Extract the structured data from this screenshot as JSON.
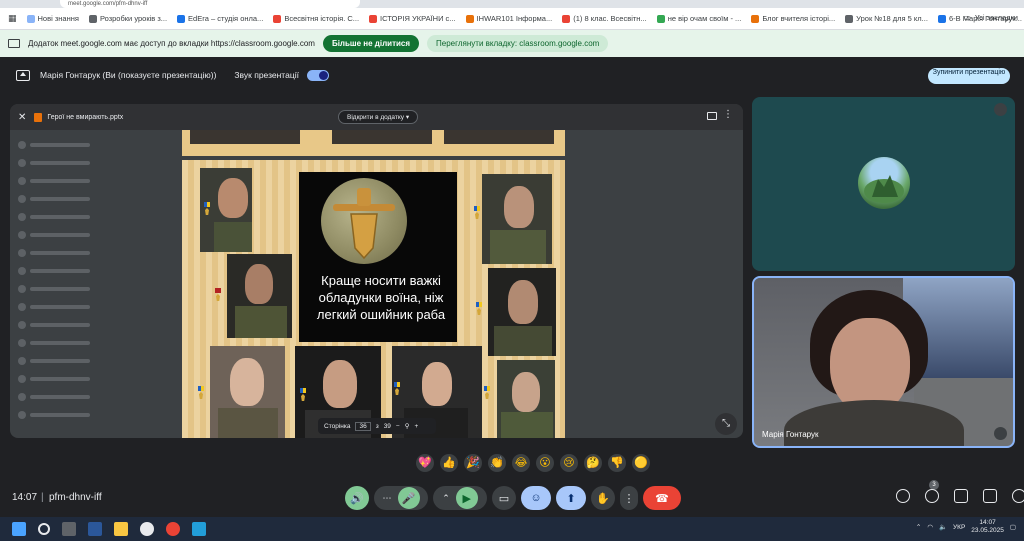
{
  "browser": {
    "tab_title": "meet.google.com/pfm-dhnv-iff",
    "bookmarks": [
      {
        "label": "Нові знання",
        "color": "#8ab4f8"
      },
      {
        "label": "Розробки уроків з...",
        "color": "#5f6368"
      },
      {
        "label": "EdEra – студія онла...",
        "color": "#1a73e8"
      },
      {
        "label": "Всесвітня історія. С...",
        "color": "#ea4335"
      },
      {
        "label": "ІСТОРІЯ УКРАЇНИ с...",
        "color": "#ea4335"
      },
      {
        "label": "IHWAR101 Інформа...",
        "color": "#e8710a"
      },
      {
        "label": "(1) 8 клас. Всесвітн...",
        "color": "#ea4335"
      },
      {
        "label": "не вір очам своїм - ...",
        "color": "#34a853"
      },
      {
        "label": "Блог вчителя історі...",
        "color": "#e8710a"
      },
      {
        "label": "Урок №18 для 5 кл...",
        "color": "#5f6368"
      },
      {
        "label": "6-В Марія Гонтарук...",
        "color": "#1a73e8"
      }
    ],
    "all_bookmarks": "Усі закладки"
  },
  "infobar": {
    "message": "Додаток meet.google.com має доступ до вкладки https://classroom.google.com",
    "stop_sharing": "Більше не ділитися",
    "switch_tab": "Переглянути вкладку: classroom.google.com"
  },
  "meet_header": {
    "presenter": "Марія Гонтарук (Ви (показуєте презентацію))",
    "audio_label": "Звук презентації",
    "stop_presenting": "Зупинити презентацію"
  },
  "viewer": {
    "file_name": "Герої не вмирають.pptx",
    "open_with": "Відкрити в додатку"
  },
  "slide": {
    "quote": "Краще носити важкі обладунки воїна, ніж легкий ошийник раба"
  },
  "page_bar": {
    "label": "Сторінка",
    "current": "36",
    "of": "з",
    "total": "39",
    "minus": "−",
    "plus": "+"
  },
  "tiles": {
    "participant_name": "Марія Гонтарук"
  },
  "reactions": [
    "💖",
    "👍",
    "🎉",
    "👏",
    "😂",
    "😮",
    "😢",
    "🤔",
    "👎",
    "🟡"
  ],
  "meeting": {
    "time": "14:07",
    "code": "pfm-dhnv-iff",
    "people_count": "3"
  },
  "taskbar": {
    "time": "14:07",
    "date": "23.05.2025",
    "lang": "УКР"
  },
  "colors": {
    "end_call": "#ea4335",
    "mic_on": "#81c995",
    "accent_blue": "#a8c7fa"
  }
}
